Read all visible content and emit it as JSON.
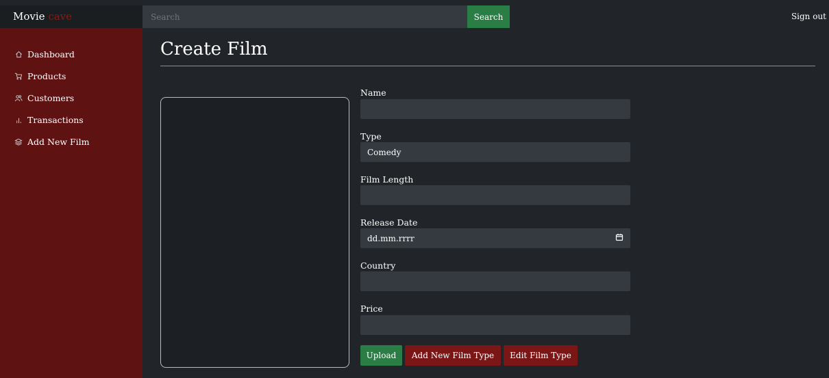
{
  "brand": {
    "name": "Movie",
    "accent": "cave"
  },
  "search": {
    "placeholder": "Search",
    "button_label": "Search"
  },
  "header": {
    "signout_label": "Sign out"
  },
  "sidebar": {
    "items": [
      {
        "label": "Dashboard",
        "icon": "home-icon"
      },
      {
        "label": "Products",
        "icon": "cart-icon"
      },
      {
        "label": "Customers",
        "icon": "users-icon"
      },
      {
        "label": "Transactions",
        "icon": "bar-chart-icon"
      },
      {
        "label": "Add New Film",
        "icon": "layers-icon"
      }
    ]
  },
  "main": {
    "title": "Create Film",
    "form": {
      "name_label": "Name",
      "name_value": "",
      "type_label": "Type",
      "type_value": "Comedy",
      "length_label": "Film Length",
      "length_value": "",
      "release_label": "Release Date",
      "release_value": "dd.mm.rrrr",
      "country_label": "Country",
      "country_value": "",
      "price_label": "Price",
      "price_value": ""
    },
    "buttons": {
      "upload": "Upload",
      "add_type": "Add New Film Type",
      "edit_type": "Edit Film Type"
    }
  },
  "colors": {
    "sidebar": "#5f1212",
    "background": "#212529",
    "success": "#2a7d44",
    "danger": "#7a1616",
    "brand_accent": "#8b1a14"
  }
}
